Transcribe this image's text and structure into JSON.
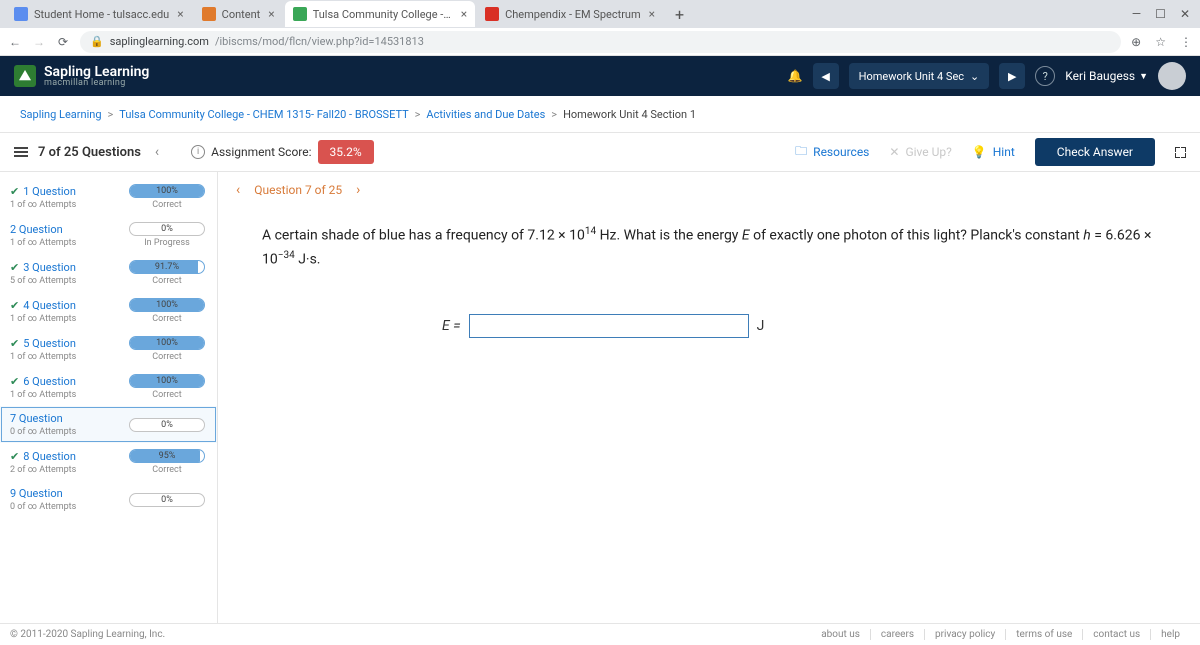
{
  "tabs": [
    {
      "label": "Student Home - tulsacc.edu",
      "favColor": "#5b8def"
    },
    {
      "label": "Content",
      "favColor": "#e07a2c"
    },
    {
      "label": "Tulsa Community College - CHE",
      "favColor": "#3aa757"
    },
    {
      "label": "Chempendix - EM Spectrum",
      "favColor": "#d93025"
    }
  ],
  "activeTab": 2,
  "url": {
    "host": "saplinglearning.com",
    "path": "/ibiscms/mod/flcn/view.php?id=14531813"
  },
  "brand": {
    "line1": "Sapling Learning",
    "line2": "macmillan learning"
  },
  "header": {
    "unitLabel": "Homework Unit 4 Sec",
    "user": "Keri Baugess"
  },
  "breadcrumb": [
    "Sapling Learning",
    "Tulsa Community College - CHEM 1315- Fall20 - BROSSETT",
    "Activities and Due Dates",
    "Homework Unit 4 Section 1"
  ],
  "toolbar": {
    "counter": "7 of 25 Questions",
    "scoreLabel": "Assignment Score:",
    "score": "35.2%",
    "resources": "Resources",
    "giveup": "Give Up?",
    "hint": "Hint",
    "check": "Check Answer"
  },
  "qnav": {
    "label": "Question 7 of 25"
  },
  "questions": [
    {
      "n": "1 Question",
      "att": "1 of ∞ Attempts",
      "pct": "100%",
      "fill": 100,
      "status": "Correct",
      "check": true
    },
    {
      "n": "2 Question",
      "att": "1 of ∞ Attempts",
      "pct": "0%",
      "fill": 0,
      "status": "In Progress",
      "check": false
    },
    {
      "n": "3 Question",
      "att": "5 of ∞ Attempts",
      "pct": "91.7%",
      "fill": 92,
      "status": "Correct",
      "check": true
    },
    {
      "n": "4 Question",
      "att": "1 of ∞ Attempts",
      "pct": "100%",
      "fill": 100,
      "status": "Correct",
      "check": true
    },
    {
      "n": "5 Question",
      "att": "1 of ∞ Attempts",
      "pct": "100%",
      "fill": 100,
      "status": "Correct",
      "check": true
    },
    {
      "n": "6 Question",
      "att": "1 of ∞ Attempts",
      "pct": "100%",
      "fill": 100,
      "status": "Correct",
      "check": true
    },
    {
      "n": "7 Question",
      "att": "0 of ∞ Attempts",
      "pct": "0%",
      "fill": 0,
      "status": "",
      "check": false,
      "selected": true
    },
    {
      "n": "8 Question",
      "att": "2 of ∞ Attempts",
      "pct": "95%",
      "fill": 95,
      "status": "Correct",
      "check": true
    },
    {
      "n": "9 Question",
      "att": "0 of ∞ Attempts",
      "pct": "0%",
      "fill": 0,
      "status": "",
      "check": false
    }
  ],
  "problem": {
    "text1": "A certain shade of blue has a frequency of 7.12 × 10",
    "exp1": "14",
    "text2": " Hz. What is the energy ",
    "eitalic": "E",
    "text3": " of exactly one photon of this light? Planck's constant ",
    "hitalic": "h",
    "text4": " = 6.626 × 10",
    "exp2": "−34",
    "text5": " J·s.",
    "ansLabel": "E =",
    "ansUnit": "J"
  },
  "footer": {
    "copy": "© 2011-2020 Sapling Learning, Inc.",
    "links": [
      "about us",
      "careers",
      "privacy policy",
      "terms of use",
      "contact us",
      "help"
    ]
  }
}
